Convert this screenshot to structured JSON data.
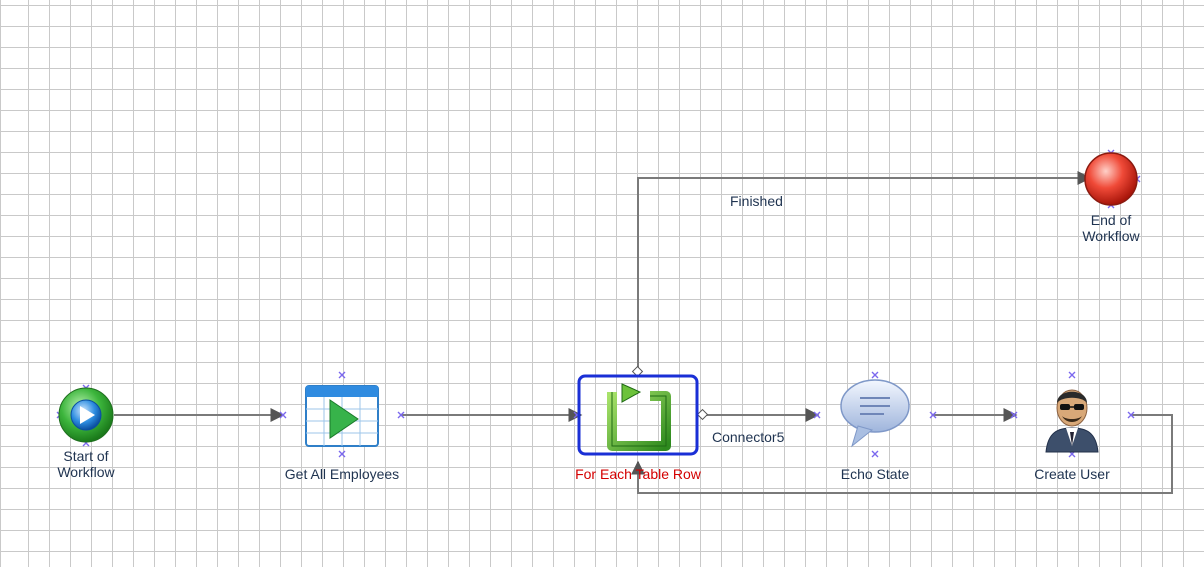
{
  "nodes": {
    "start": {
      "label": "Start of Workflow",
      "label_lines": [
        "Start of",
        "Workflow"
      ]
    },
    "get_employees": {
      "label": "Get All Employees"
    },
    "for_each": {
      "label": "For Each Table Row"
    },
    "echo": {
      "label": "Echo State"
    },
    "create_user": {
      "label": "Create User"
    },
    "end": {
      "label": "End of Workflow",
      "label_lines": [
        "End of",
        "Workflow"
      ]
    }
  },
  "connectors": {
    "finished": "Finished",
    "connector5": "Connector5"
  },
  "colors": {
    "wire": "#7a7a7a",
    "selection": "#1a2fd6",
    "error_label": "#d40000",
    "port": "#7b68ee"
  },
  "icons": {
    "start": "play-circle-icon",
    "get_employees": "table-play-icon",
    "for_each": "loop-icon",
    "echo": "speech-bubble-icon",
    "create_user": "user-agent-icon",
    "end": "stop-circle-icon"
  }
}
